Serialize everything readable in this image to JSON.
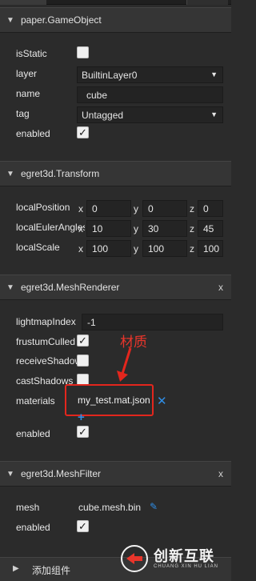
{
  "sections": {
    "gameobject": {
      "title": "paper.GameObject"
    },
    "transform": {
      "title": "egret3d.Transform"
    },
    "meshrenderer": {
      "title": "egret3d.MeshRenderer",
      "close": "x"
    },
    "meshfilter": {
      "title": "egret3d.MeshFilter",
      "close": "x"
    }
  },
  "gameobject": {
    "isStatic_label": "isStatic",
    "isStatic": false,
    "layer_label": "layer",
    "layer_value": "BuiltinLayer0",
    "name_label": "name",
    "name_value": "cube",
    "tag_label": "tag",
    "tag_value": "Untagged",
    "enabled_label": "enabled",
    "enabled": true
  },
  "transform": {
    "rows": [
      {
        "label": "localPosition",
        "x": "0",
        "y": "0",
        "z": "0"
      },
      {
        "label": "localEulerAngles",
        "x": "10",
        "y": "30",
        "z": "45"
      },
      {
        "label": "localScale",
        "x": "100",
        "y": "100",
        "z": "100"
      }
    ],
    "axis": {
      "x": "x",
      "y": "y",
      "z": "z"
    }
  },
  "meshrenderer": {
    "lightmapIndex_label": "lightmapIndex",
    "lightmapIndex_value": "-1",
    "frustumCulled_label": "frustumCulled",
    "frustumCulled": true,
    "receiveShadows_label": "receiveShadows",
    "receiveShadows": false,
    "castShadows_label": "castShadows",
    "castShadows": false,
    "materials_label": "materials",
    "materials_value": "my_test.mat.json",
    "enabled_label": "enabled",
    "enabled": true
  },
  "meshfilter": {
    "mesh_label": "mesh",
    "mesh_value": "cube.mesh.bin",
    "enabled_label": "enabled",
    "enabled": true
  },
  "annotation": "材质",
  "add_component": "添加组件",
  "watermark": {
    "main": "创新互联",
    "sub": "CHUANG XIN HU LIAN"
  },
  "colors": {
    "accent_red": "#e3261d",
    "remove_blue": "#2f8ee6",
    "panel_bg": "#2b2b2b"
  }
}
